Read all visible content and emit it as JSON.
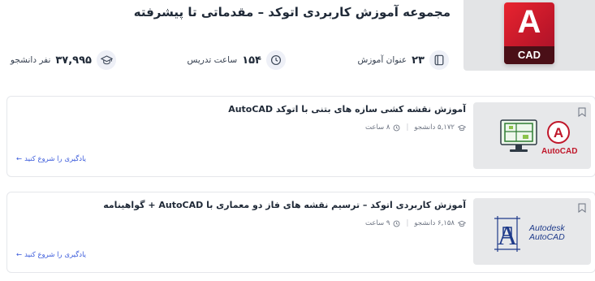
{
  "header": {
    "title": "مجموعه آموزش کاربردی اتوکد – مقدماتی تا پیشرفته",
    "logo_text": "A",
    "logo_band": "CAD",
    "stats": [
      {
        "number": "۲۳",
        "label": "عنوان آموزش",
        "icon": "book-icon"
      },
      {
        "number": "۱۵۴",
        "label": "ساعت تدریس",
        "icon": "clock-icon"
      },
      {
        "number": "۳۷,۹۹۵",
        "label": "نفر دانشجو",
        "icon": "graduation-cap-icon"
      }
    ]
  },
  "courses": [
    {
      "title": "آموزش نقشه کشی سازه های بتنی با اتوکد AutoCAD",
      "students": "۵,۱۷۲ دانشجو",
      "hours": "۸ ساعت",
      "cta": "یادگیری را شروع کنید",
      "thumb_caption": "AutoCAD"
    },
    {
      "title": "آموزش کاربردی اتوکد – ترسیم نقشه های فاز دو معماری با AutoCAD + گواهینامه",
      "students": "۶,۱۵۸ دانشجو",
      "hours": "۹ ساعت",
      "cta": "یادگیری را شروع کنید",
      "thumb_caption_line1": "Autodesk",
      "thumb_caption_line2": "AutoCAD"
    }
  ],
  "colors": {
    "brand_red": "#c0172a",
    "accent_blue": "#3b5bdb",
    "navy": "#1e3a8a"
  }
}
